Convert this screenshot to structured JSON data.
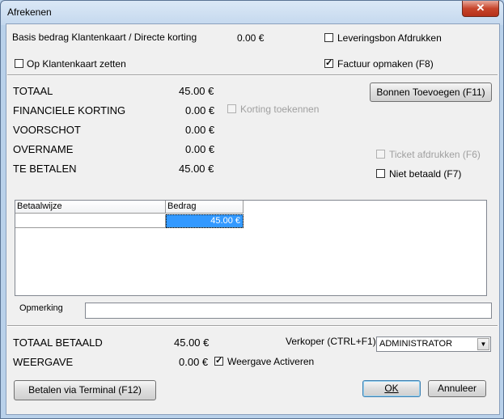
{
  "window": {
    "title": "Afrekenen",
    "close_label": "✕"
  },
  "top": {
    "basis_label": "Basis bedrag Klantenkaart / Directe korting",
    "basis_value": "0.00 €",
    "leveringsbon_label": "Leveringsbon Afdrukken",
    "leveringsbon_checked": false,
    "klantenkaart_label": "Op Klantenkaart zetten",
    "klantenkaart_checked": false,
    "factuur_label": "Factuur opmaken (F8)",
    "factuur_checked": true
  },
  "summary": [
    {
      "label": "TOTAAL",
      "value": "45.00 €"
    },
    {
      "label": "FINANCIELE KORTING",
      "value": "0.00 €"
    },
    {
      "label": "VOORSCHOT",
      "value": "0.00 €"
    },
    {
      "label": "OVERNAME",
      "value": "0.00 €"
    },
    {
      "label": "TE BETALEN",
      "value": "45.00 €"
    }
  ],
  "korting_toekennen_label": "Korting toekennen",
  "bonnen_button_label": "Bonnen Toevoegen (F11)",
  "ticket_afdrukken_label": "Ticket afdrukken (F6)",
  "niet_betaald_label": "Niet betaald (F7)",
  "grid": {
    "columns": [
      "Betaalwijze",
      "Bedrag"
    ],
    "rows": [
      {
        "betaalwijze": "",
        "bedrag": "45.00 €"
      }
    ]
  },
  "opmerking_label": "Opmerking",
  "opmerking_value": "",
  "bottom": {
    "totaal_betaald_label": "TOTAAL BETAALD",
    "totaal_betaald_value": "45.00 €",
    "weergave_label": "WEERGAVE",
    "weergave_value": "0.00 €",
    "weergave_activeren_label": "Weergave Activeren",
    "weergave_activeren_checked": true,
    "verkoper_label": "Verkoper (CTRL+F1)",
    "verkoper_value": "ADMINISTRATOR"
  },
  "buttons": {
    "terminal": "Betalen via Terminal (F12)",
    "ok": "OK",
    "annuleer": "Annuleer"
  }
}
